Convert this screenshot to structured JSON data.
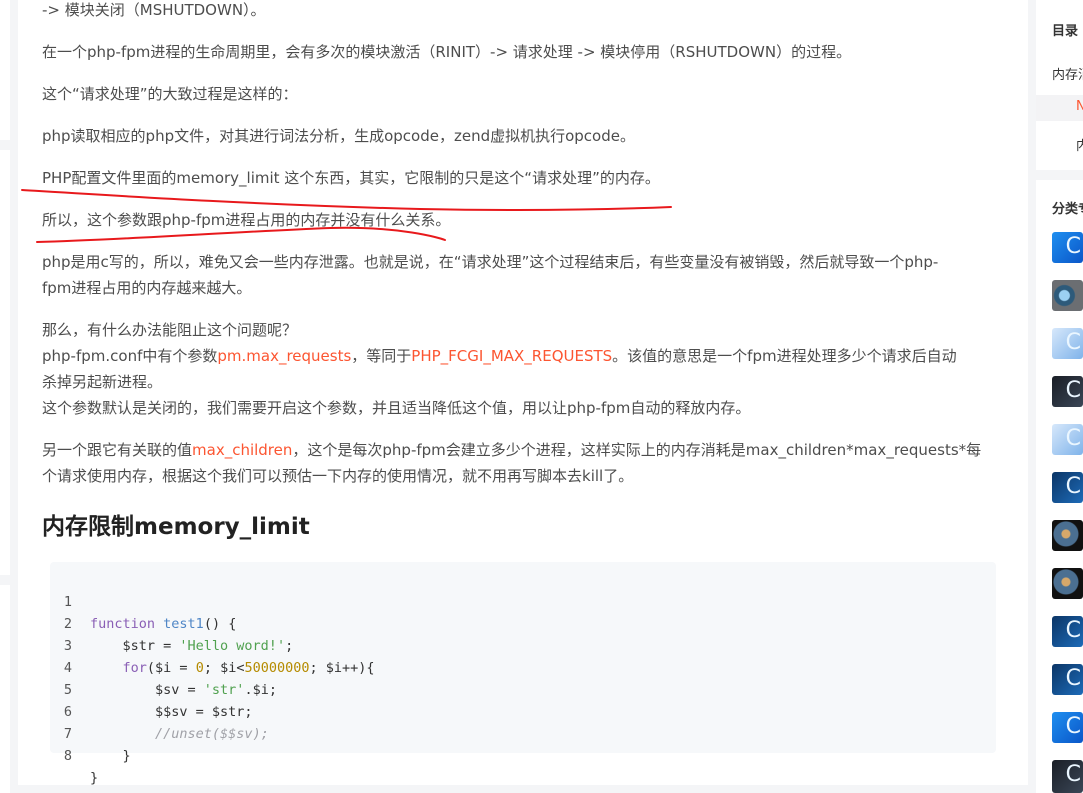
{
  "article": {
    "lines": [
      "-> 模块关闭（MSHUTDOWN）。",
      "在一个php-fpm进程的生命周期里，会有多次的模块激活（RINIT）-> 请求处理 -> 模块停用（RSHUTDOWN）的过程。",
      "这个“请求处理”的大致过程是这样的：",
      "php读取相应的php文件，对其进行词法分析，生成opcode，zend虚拟机执行opcode。",
      "PHP配置文件里面的memory_limit 这个东西，其实，它限制的只是这个“请求处理”的内存。",
      "所以，这个参数跟php-fpm进程占用的内存并没有什么关系。",
      "php是用c写的，所以，难免又会一些内存泄露。也就是说，在“请求处理”这个过程结束后，有些变量没有被销毁，然后就导致一个php-",
      "fpm进程占用的内存越来越大。",
      "那么，有什么办法能阻止这个问题呢？"
    ],
    "para_maxreq": {
      "t1": "php-fpm.conf中有个参数",
      "r1": "pm.max_requests",
      "t2": "，等同于",
      "r2": "PHP_FCGI_MAX_REQUESTS",
      "t3": "。该值的意思是一个fpm进程处理多少个请求后自动",
      "t4": "杀掉另起新进程。"
    },
    "line_default_off": "这个参数默认是关闭的，我们需要开启这个参数，并且适当降低这个值，用以让php-fpm自动的释放内存。",
    "para_children": {
      "t1": "另一个跟它有关联的值",
      "r1": "max_children",
      "t2": "，这个是每次php-fpm会建立多少个进程，这样实际上的内存消耗是max_children*max_requests*每",
      "t3": "个请求使用内存，根据这个我们可以预估一下内存的使用情况，就不用再写脚本去kill了。"
    },
    "heading": "内存限制memory_limit"
  },
  "code": {
    "line_numbers": [
      "1",
      "2",
      "3",
      "4",
      "5",
      "6",
      "7",
      "8"
    ],
    "l1": {
      "kw": "function",
      "fn": "test1",
      "rest": "() {"
    },
    "l2": {
      "a": "    $str = ",
      "s": "'Hello word!'",
      "b": ";"
    },
    "l3": {
      "indent": "    ",
      "kw": "for",
      "a": "($i = ",
      "n1": "0",
      "b": "; $i<",
      "n2": "50000000",
      "c": "; $i++){"
    },
    "l4": {
      "a": "        $sv = ",
      "s": "'str'",
      "b": ".$i;"
    },
    "l5": {
      "a": "        $$sv = $str;"
    },
    "l6": {
      "indent": "        ",
      "cm": "//unset($$sv);"
    },
    "l7": {
      "a": "    }"
    },
    "l8": {
      "a": "}"
    }
  },
  "sidebar": {
    "toc_title": "目录",
    "toc_item_1": "内存消",
    "toc_item_2": "N",
    "toc_item_3": "内",
    "category_title": "分类专",
    "thumb_glyph": "C"
  },
  "colors": {
    "accent_red": "#fc5531",
    "annotation_red": "#e8191c",
    "text": "#4d4d4d"
  }
}
